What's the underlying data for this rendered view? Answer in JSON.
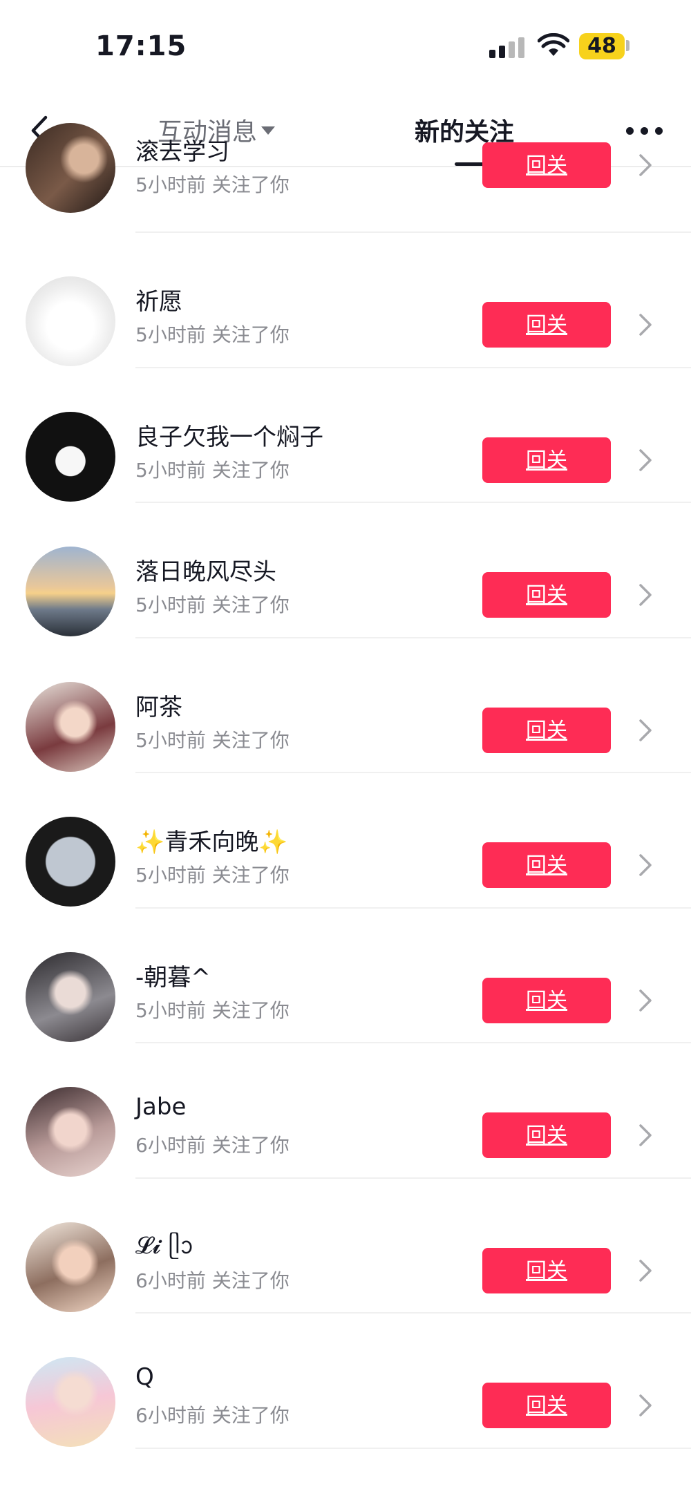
{
  "status_bar": {
    "time": "17:15",
    "battery": "48"
  },
  "nav": {
    "tab_interact": "互动消息",
    "tab_follow": "新的关注"
  },
  "follow_back_label": "回关",
  "followers": [
    {
      "name": "滚去学习",
      "meta": "5小时前 关注了你",
      "button": "回关"
    },
    {
      "name": "祈愿",
      "meta": "5小时前 关注了你",
      "button": "回关"
    },
    {
      "name": "良子欠我一个焖子",
      "meta": "5小时前 关注了你",
      "button": "回关"
    },
    {
      "name": "落日晚风尽头",
      "meta": "5小时前 关注了你",
      "button": "回关"
    },
    {
      "name": "阿茶",
      "meta": "5小时前 关注了你",
      "button": "回关"
    },
    {
      "name": "✨青禾向晚✨",
      "meta": "5小时前 关注了你",
      "button": "回关"
    },
    {
      "name": "-朝暮^",
      "meta": "5小时前 关注了你",
      "button": "回关"
    },
    {
      "name": "Jabe",
      "meta": "6小时前 关注了你",
      "button": "回关"
    },
    {
      "name": "𝓛𝓲 ᥫᩣ",
      "meta": "6小时前 关注了你",
      "button": "回关"
    },
    {
      "name": "Q",
      "meta": "6小时前 关注了你",
      "button": "回关"
    }
  ],
  "colors": {
    "accent": "#fe2c55",
    "text": "#161823",
    "subtext": "#8a8b91"
  },
  "icons": [
    "back-arrow-icon",
    "caret-down-icon",
    "more-icon",
    "chevron-right-icon",
    "signal-icon",
    "wifi-icon",
    "battery-icon"
  ]
}
